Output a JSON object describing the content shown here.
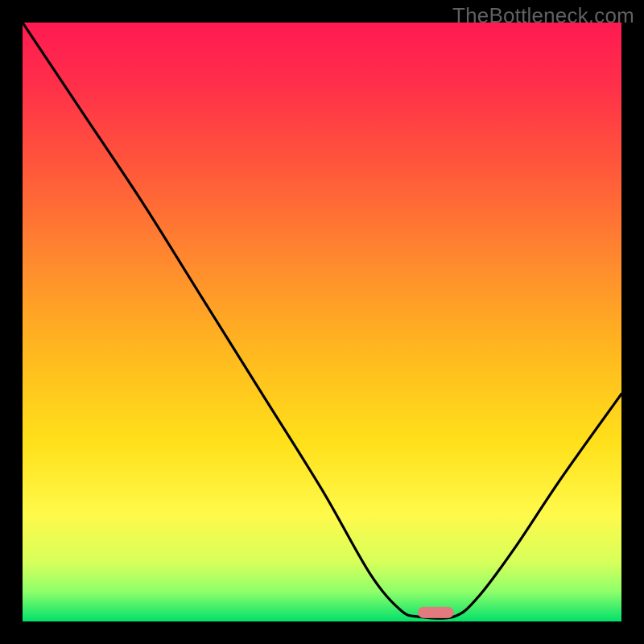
{
  "watermark": "TheBottleneck.com",
  "chart_data": {
    "type": "line",
    "title": "",
    "xlabel": "",
    "ylabel": "",
    "xlim": [
      0,
      100
    ],
    "ylim": [
      0,
      100
    ],
    "optimum_marker": {
      "x_start": 66,
      "x_end": 72,
      "y": 1.5,
      "color": "#e27a7f"
    },
    "curve": [
      {
        "x": 0,
        "y": 100
      },
      {
        "x": 10,
        "y": 85
      },
      {
        "x": 20,
        "y": 70
      },
      {
        "x": 30,
        "y": 54
      },
      {
        "x": 40,
        "y": 38
      },
      {
        "x": 50,
        "y": 22
      },
      {
        "x": 58,
        "y": 8
      },
      {
        "x": 63,
        "y": 2
      },
      {
        "x": 66,
        "y": 0.8
      },
      {
        "x": 72,
        "y": 0.8
      },
      {
        "x": 76,
        "y": 4
      },
      {
        "x": 82,
        "y": 12
      },
      {
        "x": 90,
        "y": 24
      },
      {
        "x": 100,
        "y": 38
      }
    ],
    "gradient_stops": [
      {
        "offset": 0.0,
        "color": "#ff1a52"
      },
      {
        "offset": 0.1,
        "color": "#ff2e4a"
      },
      {
        "offset": 0.25,
        "color": "#ff5a3a"
      },
      {
        "offset": 0.4,
        "color": "#ff8a2e"
      },
      {
        "offset": 0.55,
        "color": "#ffb81f"
      },
      {
        "offset": 0.7,
        "color": "#ffe01a"
      },
      {
        "offset": 0.82,
        "color": "#fff94a"
      },
      {
        "offset": 0.9,
        "color": "#d8ff5a"
      },
      {
        "offset": 0.95,
        "color": "#8fff6a"
      },
      {
        "offset": 1.0,
        "color": "#00e06a"
      }
    ]
  }
}
